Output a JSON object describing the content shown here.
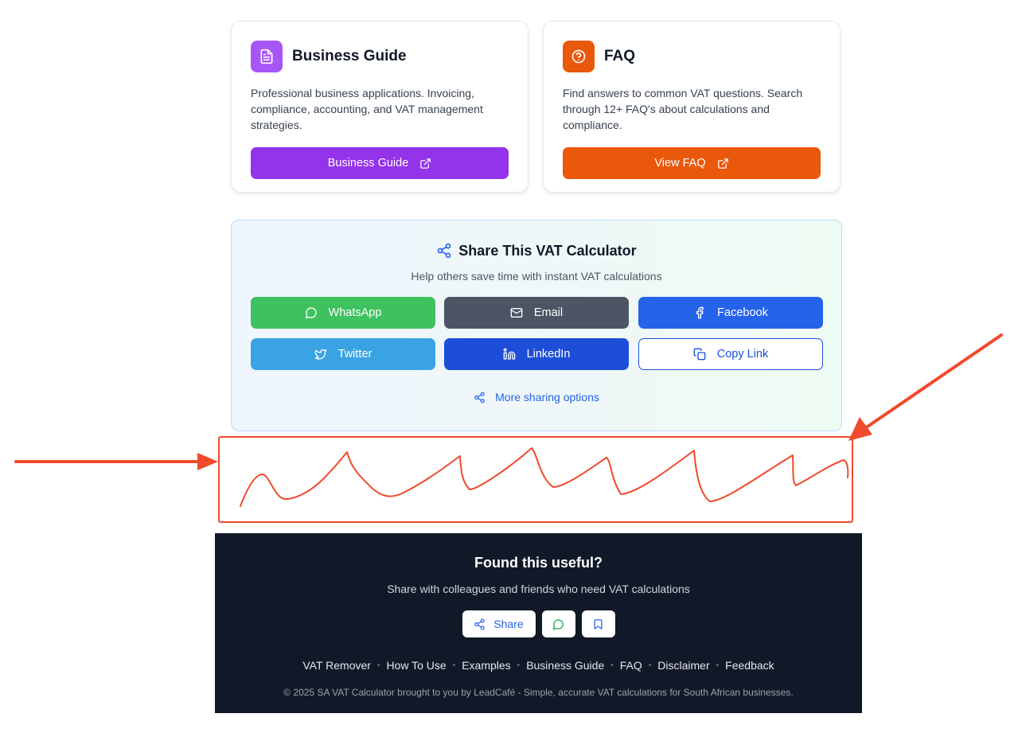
{
  "cards": [
    {
      "title": "Business Guide",
      "description": "Professional business applications. Invoicing, compliance, accounting, and VAT management strategies.",
      "button_label": "Business Guide",
      "color": "#9333ea",
      "icon": "document-icon"
    },
    {
      "title": "FAQ",
      "description": "Find answers to common VAT questions. Search through 12+ FAQ's about calculations and compliance.",
      "button_label": "View FAQ",
      "color": "#ea580c",
      "icon": "question-circle-icon"
    }
  ],
  "share": {
    "title": "Share This VAT Calculator",
    "subtitle": "Help others save time with instant VAT calculations",
    "buttons": {
      "whatsapp": "WhatsApp",
      "email": "Email",
      "facebook": "Facebook",
      "twitter": "Twitter",
      "linkedin": "LinkedIn",
      "copy_link": "Copy Link"
    },
    "more_options": "More sharing options",
    "colors": {
      "whatsapp": "#3ec15e",
      "email": "#4b5563",
      "facebook": "#2563eb",
      "twitter": "#3aa3e3",
      "linkedin": "#1d4ed8",
      "copy_link_border": "#1d4ed8"
    }
  },
  "annotation": {
    "color": "#f04a2c",
    "description": "red hand-drawn box with arrows marking empty area below share panel"
  },
  "footer": {
    "title": "Found this useful?",
    "subtitle": "Share with colleagues and friends who need VAT calculations",
    "share_label": "Share",
    "links": [
      "VAT Remover",
      "How To Use",
      "Examples",
      "Business Guide",
      "FAQ",
      "Disclaimer",
      "Feedback"
    ],
    "copyright": "© 2025 SA VAT Calculator brought to you by LeadCafé - Simple, accurate VAT calculations for South African businesses.",
    "background": "#111827"
  }
}
